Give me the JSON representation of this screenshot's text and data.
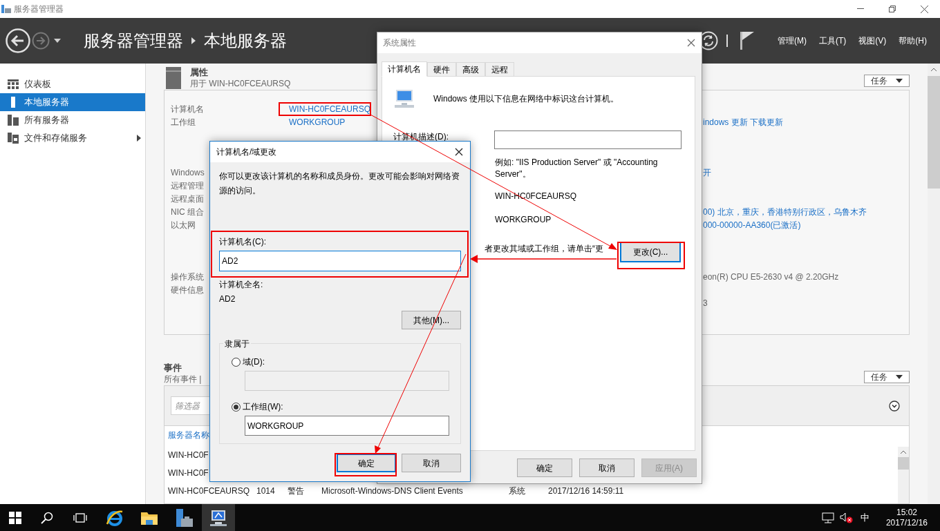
{
  "window": {
    "title": "服务器管理器"
  },
  "header": {
    "breadcrumb": [
      "服务器管理器",
      "本地服务器"
    ],
    "menus": [
      "管理(M)",
      "工具(T)",
      "视图(V)",
      "帮助(H)"
    ]
  },
  "sidebar": {
    "items": [
      {
        "label": "仪表板",
        "kind": "dashboard",
        "selected": false,
        "expandable": false
      },
      {
        "label": "本地服务器",
        "kind": "server",
        "selected": true,
        "expandable": false
      },
      {
        "label": "所有服务器",
        "kind": "servers",
        "selected": false,
        "expandable": false
      },
      {
        "label": "文件和存储服务",
        "kind": "storage",
        "selected": false,
        "expandable": true
      }
    ]
  },
  "properties": {
    "title": "属性",
    "subtitle": "用于 WIN-HC0FCEAURSQ",
    "tasks_button": "任务",
    "groups": [
      [
        {
          "label": "计算机名",
          "value": "WIN-HC0FCEAURSQ"
        },
        {
          "label": "工作组",
          "value": "WORKGROUP"
        }
      ],
      [
        {
          "label": "Windows"
        },
        {
          "label": "远程管理"
        },
        {
          "label": "远程桌面"
        },
        {
          "label": "NIC 组合"
        },
        {
          "label": "以太网"
        }
      ],
      [
        {
          "label": "操作系统"
        },
        {
          "label": "硬件信息"
        }
      ]
    ],
    "right_values": {
      "windows_update": "indows 更新 下载更新",
      "remote": "开",
      "time_zone": "00) 北京，重庆，香港特别行政区，乌鲁木齐",
      "product_id": "000-00000-AA360(已激活)",
      "processor": "eon(R) CPU E5-2630 v4 @ 2.20GHz",
      "memory": "3"
    }
  },
  "events": {
    "title": "事件",
    "subtitle": "所有事件 |",
    "tasks_button": "任务",
    "filter_placeholder": "筛选器",
    "column_1": "服务器名称",
    "rows": [
      [
        "WIN-HC0F"
      ],
      [
        "WIN-HC0F"
      ],
      [
        "WIN-HC0FCEAURSQ",
        "1014",
        "警告",
        "Microsoft-Windows-DNS Client Events",
        "系统",
        "2017/12/16 14:59:11"
      ]
    ]
  },
  "system_properties": {
    "title": "系统属性",
    "tabs": [
      {
        "label": "计算机名",
        "selected": true
      },
      {
        "label": "硬件",
        "selected": false
      },
      {
        "label": "高级",
        "selected": false
      },
      {
        "label": "远程",
        "selected": false
      }
    ],
    "intro": "Windows 使用以下信息在网络中标识这台计算机。",
    "description_label": "计算机描述(D):",
    "example": "例如: \"IIS Production Server\" 或 \"Accounting Server\"。",
    "full_name": "WIN-HC0FCEAURSQ",
    "workgroup": "WORKGROUP",
    "change_hint": "者更改其域或工作组，请单击“更",
    "change_button": "更改(C)...",
    "buttons": [
      {
        "label": "确定",
        "disabled": false
      },
      {
        "label": "取消",
        "disabled": false
      },
      {
        "label": "应用(A)",
        "disabled": true
      }
    ]
  },
  "name_change_dialog": {
    "title": "计算机名/域更改",
    "description": "你可以更改该计算机的名称和成员身份。更改可能会影响对网络资源的访问。",
    "name_label": "计算机名(C):",
    "name_value": "AD2",
    "full_name_label": "计算机全名:",
    "full_name": "AD2",
    "more_button": "其他(M)...",
    "member_of": {
      "legend": "隶属于",
      "options": [
        {
          "label": "域(D):",
          "selected": false
        },
        {
          "label": "工作组(W):",
          "selected": true,
          "value": "WORKGROUP"
        }
      ]
    },
    "buttons": [
      {
        "label": "确定",
        "default": true
      },
      {
        "label": "取消",
        "default": false
      }
    ]
  },
  "taskbar": {
    "apps": [
      {
        "kind": "ie",
        "active": false
      },
      {
        "kind": "explorer",
        "active": false
      },
      {
        "kind": "server-manager",
        "active": false
      },
      {
        "kind": "system",
        "active": true
      }
    ],
    "ime": "中",
    "time": "15:02",
    "date": "2017/12/16"
  }
}
